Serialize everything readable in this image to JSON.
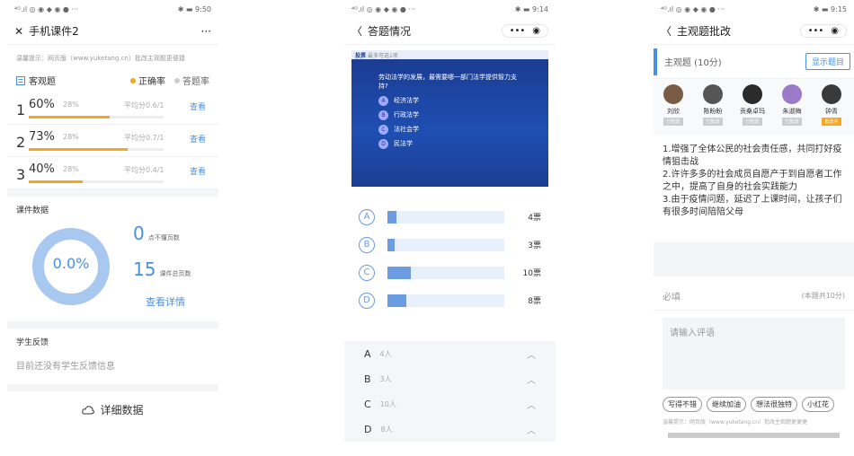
{
  "panel1": {
    "status_left": "⁴ᴳ.ıl ◎ ◉ ◆ ◉ ● ···",
    "status_right": "✱ ▬ 9:50",
    "close_label": "✕",
    "title": "手机课件2",
    "more_label": "···",
    "tip": "温馨提示：网页版（www.yuketang.cn）批改主观题更便捷",
    "objective_label": "客观题",
    "legend_correct": "正确率",
    "legend_answer": "答题率",
    "questions": [
      {
        "num": "1",
        "correct": "60%",
        "answer": "28%",
        "avg": "平均分0.6/1",
        "link": "查看",
        "fill": 0.6
      },
      {
        "num": "2",
        "correct": "73%",
        "answer": "28%",
        "avg": "平均分0.7/1",
        "link": "查看",
        "fill": 0.73
      },
      {
        "num": "3",
        "correct": "40%",
        "answer": "28%",
        "avg": "平均分0.4/1",
        "link": "查看",
        "fill": 0.4
      }
    ],
    "courseware_label": "课件数据",
    "ring_value": "0.0%",
    "stat1_value": "0",
    "stat1_label": "点不懂页数",
    "stat2_value": "15",
    "stat2_label": "课件总页数",
    "detail_link": "查看详情",
    "feedback_label": "学生反馈",
    "feedback_empty": "目前还没有学生反馈信息",
    "detail_data_label": "详细数据",
    "colors": {
      "orange": "#f5a623",
      "blue": "#4a90e2",
      "ring": "#a9c8f0"
    }
  },
  "panel2": {
    "status_left": "⁴ᴳ.ıl ◎ ◉ ◆ ◉ ● ···",
    "status_right": "✱ ▬ 9:14",
    "back_label": "〈",
    "title": "答题情况",
    "capsule_dots": "•••",
    "capsule_target": "◉",
    "slide": {
      "tag": "投票",
      "tag_sub": "最多可选1项",
      "question": "劳动法学的发展，最需要哪一部门法学提供智力支持?",
      "options": [
        {
          "key": "A",
          "text": "经济法学"
        },
        {
          "key": "B",
          "text": "行政法学"
        },
        {
          "key": "C",
          "text": "法社会学"
        },
        {
          "key": "D",
          "text": "民法学"
        }
      ]
    },
    "votes": [
      {
        "key": "A",
        "count": "4票",
        "fraction": 0.4
      },
      {
        "key": "B",
        "count": "3票",
        "fraction": 0.3
      },
      {
        "key": "C",
        "count": "10票",
        "fraction": 1.0
      },
      {
        "key": "D",
        "count": "8票",
        "fraction": 0.8
      }
    ],
    "list": [
      {
        "key": "A",
        "people": "4人"
      },
      {
        "key": "B",
        "people": "3人"
      },
      {
        "key": "C",
        "people": "10人"
      },
      {
        "key": "D",
        "people": "8人"
      }
    ]
  },
  "panel3": {
    "status_left": "⁴ᴳ.ıl ◎ ◉ ◆ ◉ ● ···",
    "status_right": "✱ ▬ 9:15",
    "back_label": "〈",
    "title": "主观题批改",
    "capsule_dots": "•••",
    "capsule_target": "◉",
    "subj_title": "主观题 (10分)",
    "show_btn": "显示题目",
    "students": [
      {
        "name": "刘欣",
        "badge": "已批改"
      },
      {
        "name": "陈盼盼",
        "badge": "已批改"
      },
      {
        "name": "贡桑卓玛",
        "badge": "已批改"
      },
      {
        "name": "朱淑梅",
        "badge": "已批改"
      },
      {
        "name": "钟青",
        "badge": "批改中"
      }
    ],
    "answer_lines": [
      "1.增强了全体公民的社会责任感，共同打好疫情狙击战",
      "2.许许多多的社会成员自愿产于到自愿者工作之中，提高了自身的社会实践能力",
      "3.由于疫情问题，延迟了上课时间，让孩子们有很多时间陪陪父母"
    ],
    "must_label": "必填",
    "must_hint": "(本题共10分)",
    "comment_placeholder": "请输入评语",
    "tags": [
      "写得不错",
      "继续加油",
      "想法很独特",
      "小红花"
    ],
    "foot_tip": "温馨提示：网页版（www.yuketang.cn）批改主观题更便捷"
  }
}
